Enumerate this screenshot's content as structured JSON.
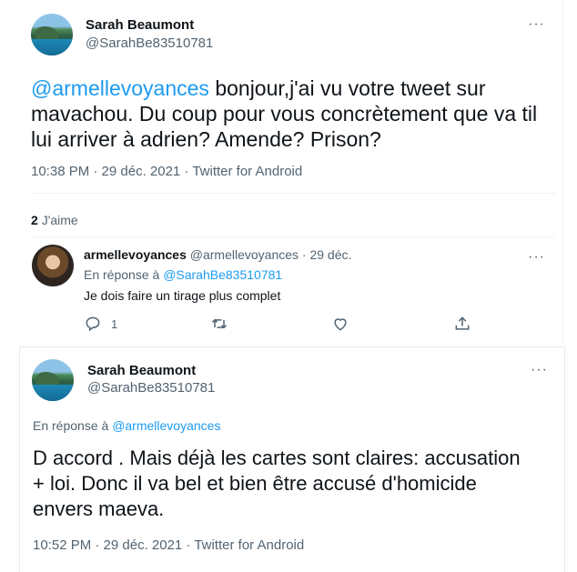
{
  "tweet1": {
    "author_name": "Sarah Beaumont",
    "author_handle": "@SarahBe83510781",
    "more": "···",
    "mention": "@armellevoyances",
    "text_line1": " bonjour,j'ai vu votre tweet sur",
    "text_line2": "mavachou. Du coup pour vous concrètement que va til",
    "text_line3": "lui arriver à adrien? Amende? Prison?",
    "meta": "10:38 PM · 29 déc. 2021 · Twitter for Android",
    "likes_count": "2",
    "likes_label": "J'aime"
  },
  "reply": {
    "author_name": "armellevoyances",
    "author_handle": "@armellevoyances",
    "separator": "·",
    "date": "29 déc.",
    "more": "···",
    "reply_to_label": "En réponse à",
    "reply_to_handle": "@SarahBe83510781",
    "text": "Je dois faire un tirage plus complet",
    "reply_count": "1"
  },
  "tweet2": {
    "author_name": "Sarah Beaumont",
    "author_handle": "@SarahBe83510781",
    "more": "···",
    "reply_to_label": "En réponse à",
    "reply_to_handle": "@armellevoyances",
    "text_line1": "D accord . Mais déjà les cartes sont claires: accusation",
    "text_line2": "+ loi. Donc il va bel et bien être accusé d'homicide",
    "text_line3": "envers maeva.",
    "meta": "10:52 PM · 29 déc. 2021 · Twitter for Android"
  },
  "icons": [
    "reply-icon",
    "retweet-icon",
    "like-icon",
    "share-icon",
    "more-icon"
  ]
}
